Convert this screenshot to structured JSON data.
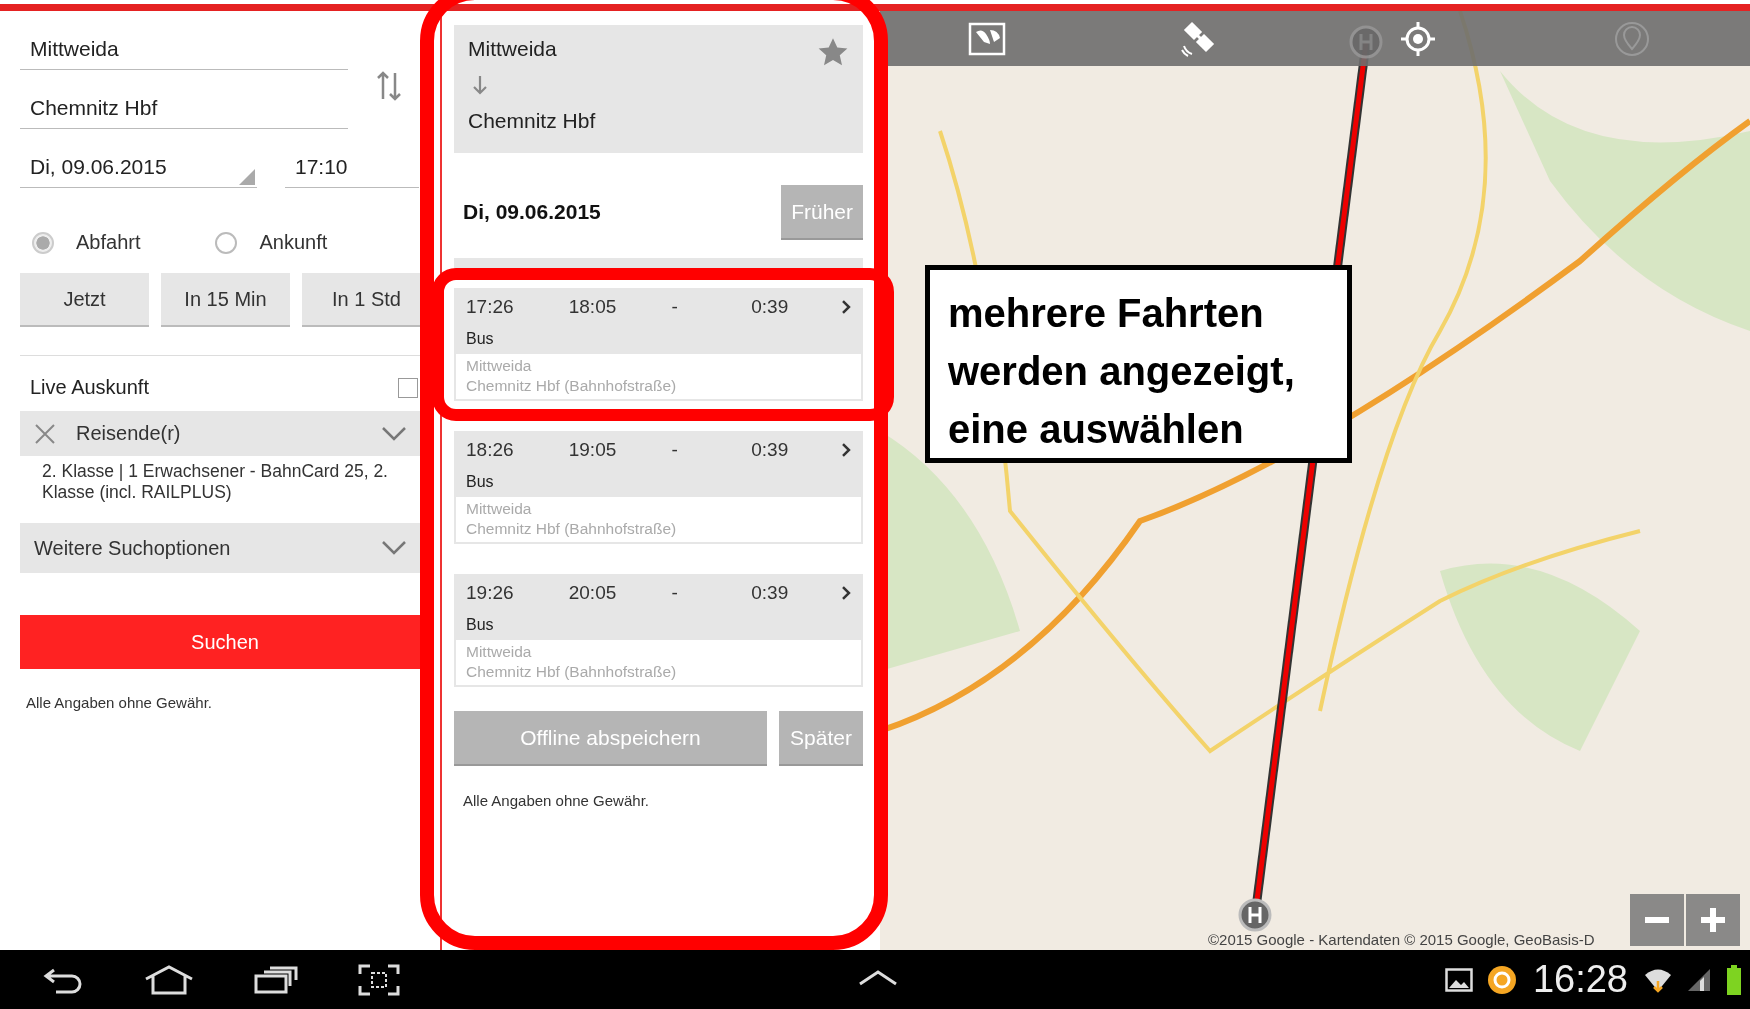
{
  "search": {
    "from": "Mittweida",
    "to": "Chemnitz Hbf",
    "date": "Di, 09.06.2015",
    "time": "17:10",
    "mode_options": [
      {
        "label": "Abfahrt",
        "selected": true
      },
      {
        "label": "Ankunft",
        "selected": false
      }
    ],
    "quick_buttons": [
      "Jetzt",
      "In 15 Min",
      "In 1 Std"
    ],
    "live": {
      "label": "Live Auskunft",
      "checked": false
    },
    "travellers": {
      "label": "Reisende(r)",
      "description": "2. Klasse | 1 Erwachsener - BahnCard 25, 2. Klasse (incl. RAILPLUS)"
    },
    "more_options": {
      "label": "Weitere Suchoptionen"
    },
    "search_button": "Suchen",
    "disclaimer": "Alle Angaben ohne Gewähr."
  },
  "results": {
    "from": "Mittweida",
    "to": "Chemnitz Hbf",
    "date": "Di, 09.06.2015",
    "earlier_button": "Früher",
    "connections": [
      {
        "departure": "17:26",
        "arrival": "18:05",
        "changes": "-",
        "duration": "0:39",
        "product": "Bus",
        "start_stop": "Mittweida",
        "end_stop": "Chemnitz Hbf (Bahnhofstraße)"
      },
      {
        "departure": "18:26",
        "arrival": "19:05",
        "changes": "-",
        "duration": "0:39",
        "product": "Bus",
        "start_stop": "Mittweida",
        "end_stop": "Chemnitz Hbf (Bahnhofstraße)"
      },
      {
        "departure": "19:26",
        "arrival": "20:05",
        "changes": "-",
        "duration": "0:39",
        "product": "Bus",
        "start_stop": "Mittweida",
        "end_stop": "Chemnitz Hbf (Bahnhofstraße)"
      }
    ],
    "save_button": "Offline abspeichern",
    "later_button": "Später",
    "disclaimer": "Alle Angaben ohne Gewähr."
  },
  "map": {
    "attribution": "©2015 Google - Kartendaten © 2015 Google, GeoBasis-D"
  },
  "annotation": {
    "text": "mehrere Fahrten werden angezeigt, eine auswählen"
  },
  "status_bar": {
    "time": "16:28"
  }
}
